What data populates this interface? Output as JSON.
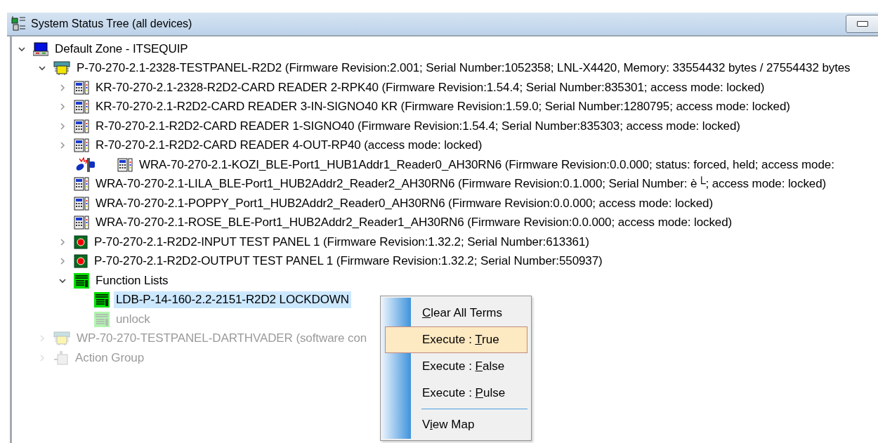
{
  "window": {
    "title": "System Status Tree (all devices)"
  },
  "tree": [
    {
      "label": "Default Zone - ITSEQUIP",
      "kind": "zone",
      "expanded": true,
      "faded": false,
      "selected": false,
      "children": [
        {
          "label": "P-70-270-2.1-2328-TESTPANEL-R2D2 (Firmware Revision:2.001; Serial Number:1052358; LNL-X4420, Memory: 33554432 bytes / 27554432 bytes",
          "kind": "panel",
          "expanded": true,
          "faded": false,
          "selected": false,
          "children": [
            {
              "label": "KR-70-270-2.1-2328-R2D2-CARD READER 2-RPK40 (Firmware Revision:1.54.4; Serial Number:835301; access mode: locked)",
              "kind": "reader",
              "expanded": false,
              "faded": false,
              "selected": false
            },
            {
              "label": "KR-70-270-2.1-R2D2-CARD READER 3-IN-SIGNO40 KR (Firmware Revision:1.59.0; Serial Number:1280795; access mode: locked)",
              "kind": "reader",
              "expanded": false,
              "faded": false,
              "selected": false
            },
            {
              "label": "R-70-270-2.1-R2D2-CARD READER 1-SIGNO40 (Firmware Revision:1.54.4; Serial Number:835303; access mode: locked)",
              "kind": "reader",
              "expanded": false,
              "faded": false,
              "selected": false
            },
            {
              "label": "R-70-270-2.1-R2D2-CARD READER 4-OUT-RP40 (access mode: locked)",
              "kind": "reader",
              "expanded": false,
              "faded": false,
              "selected": false
            },
            {
              "label": "WRA-70-270-2.1-KOZI_BLE-Port1_HUB1Addr1_Reader0_AH30RN6 (Firmware Revision:0.0.000; status: forced, held; access mode:",
              "kind": "reader",
              "alarm": true,
              "faded": false,
              "selected": false
            },
            {
              "label": "WRA-70-270-2.1-LILA_BLE-Port1_HUB2Addr2_Reader2_AH30RN6 (Firmware Revision:0.1.000; Serial Number: è└; access mode: locked)",
              "kind": "reader",
              "faded": false,
              "selected": false
            },
            {
              "label": "WRA-70-270-2.1-POPPY_Port1_HUB2Addr2_Reader0_AH30RN6 (Firmware Revision:0.0.000; access mode: locked)",
              "kind": "reader",
              "faded": false,
              "selected": false
            },
            {
              "label": "WRA-70-270-2.1-ROSE_BLE-Port1_HUB2Addr2_Reader1_AH30RN6 (Firmware Revision:0.0.000; access mode: locked)",
              "kind": "reader",
              "faded": false,
              "selected": false
            },
            {
              "label": "P-70-270-2.1-R2D2-INPUT TEST PANEL 1 (Firmware Revision:1.32.2; Serial Number:613361)",
              "kind": "io",
              "expanded": false,
              "faded": false,
              "selected": false
            },
            {
              "label": "P-70-270-2.1-R2D2-OUTPUT TEST PANEL 1 (Firmware Revision:1.32.2; Serial Number:550937)",
              "kind": "io",
              "expanded": false,
              "faded": false,
              "selected": false
            },
            {
              "label": "Function Lists",
              "kind": "func",
              "expanded": true,
              "faded": false,
              "selected": false,
              "children": [
                {
                  "label": "LDB-P-14-160-2.2-2151-R2D2 LOCKDOWN",
                  "kind": "func",
                  "faded": false,
                  "selected": true
                },
                {
                  "label": "unlock",
                  "kind": "func",
                  "faded": true,
                  "selected": false
                }
              ]
            }
          ]
        },
        {
          "label": "WP-70-270-TESTPANEL-DARTHVADER (software con",
          "kind": "panel",
          "expanded": false,
          "faded": true,
          "selected": false
        },
        {
          "label": "Action Group",
          "kind": "action",
          "expanded": false,
          "faded": true,
          "selected": false
        }
      ]
    }
  ],
  "context_menu": [
    {
      "kind": "item",
      "key": "C",
      "after": "lear All Terms",
      "selected": false
    },
    {
      "kind": "item",
      "before": "Execute : ",
      "key": "T",
      "after": "rue",
      "selected": true
    },
    {
      "kind": "item",
      "before": "Execute : ",
      "key": "F",
      "after": "alse",
      "selected": false
    },
    {
      "kind": "item",
      "before": "Execute : ",
      "key": "P",
      "after": "ulse",
      "selected": false
    },
    {
      "kind": "separator"
    },
    {
      "kind": "item",
      "before": "V",
      "key": "i",
      "after": "ew Map",
      "selected": false
    }
  ]
}
